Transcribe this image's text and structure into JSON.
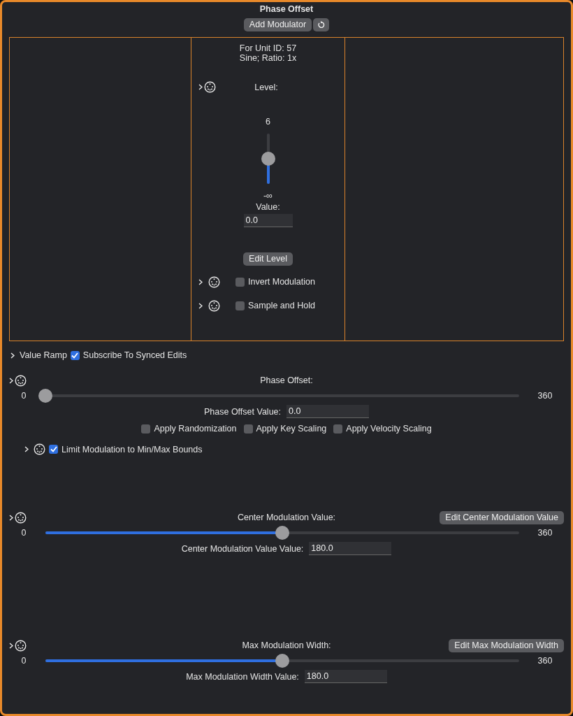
{
  "title": "Phase Offset",
  "add_button": "Add Modulator",
  "modulator": {
    "unit": "For Unit ID:  57",
    "wave": "Sine; Ratio: 1x",
    "level_label": "Level:",
    "max_label": "6",
    "min_label": "-∞",
    "level": 0.5,
    "value_label": "Value:",
    "value": "0.0",
    "edit_button": "Edit Level",
    "options": [
      {
        "label": "Invert Modulation",
        "checked": false
      },
      {
        "label": "Sample and Hold",
        "checked": false
      }
    ]
  },
  "value_ramp": {
    "label": "Value Ramp",
    "subscribe": {
      "label": "Subscribe To Synced Edits",
      "checked": true
    }
  },
  "params": [
    {
      "title": "Phase Offset:",
      "min": "0",
      "max": "360",
      "level": 0,
      "value_label": "Phase Offset Value:",
      "value": "0.0",
      "options": [
        {
          "label": "Apply Randomization",
          "checked": false
        },
        {
          "label": "Apply Key Scaling",
          "checked": false
        },
        {
          "label": "Apply Velocity Scaling",
          "checked": false
        }
      ],
      "limit": {
        "label": "Limit Modulation to Min/Max Bounds",
        "checked": true
      }
    },
    {
      "title": "Center Modulation Value:",
      "min": "0",
      "max": "360",
      "level": 0.5,
      "value_label": "Center Modulation Value Value:",
      "value": "180.0",
      "edit_button": "Edit Center Modulation Value"
    },
    {
      "title": "Max Modulation Width:",
      "min": "0",
      "max": "360",
      "level": 0.5,
      "value_label": "Max Modulation Width Value:",
      "value": "180.0",
      "edit_button": "Edit Max Modulation Width"
    }
  ]
}
